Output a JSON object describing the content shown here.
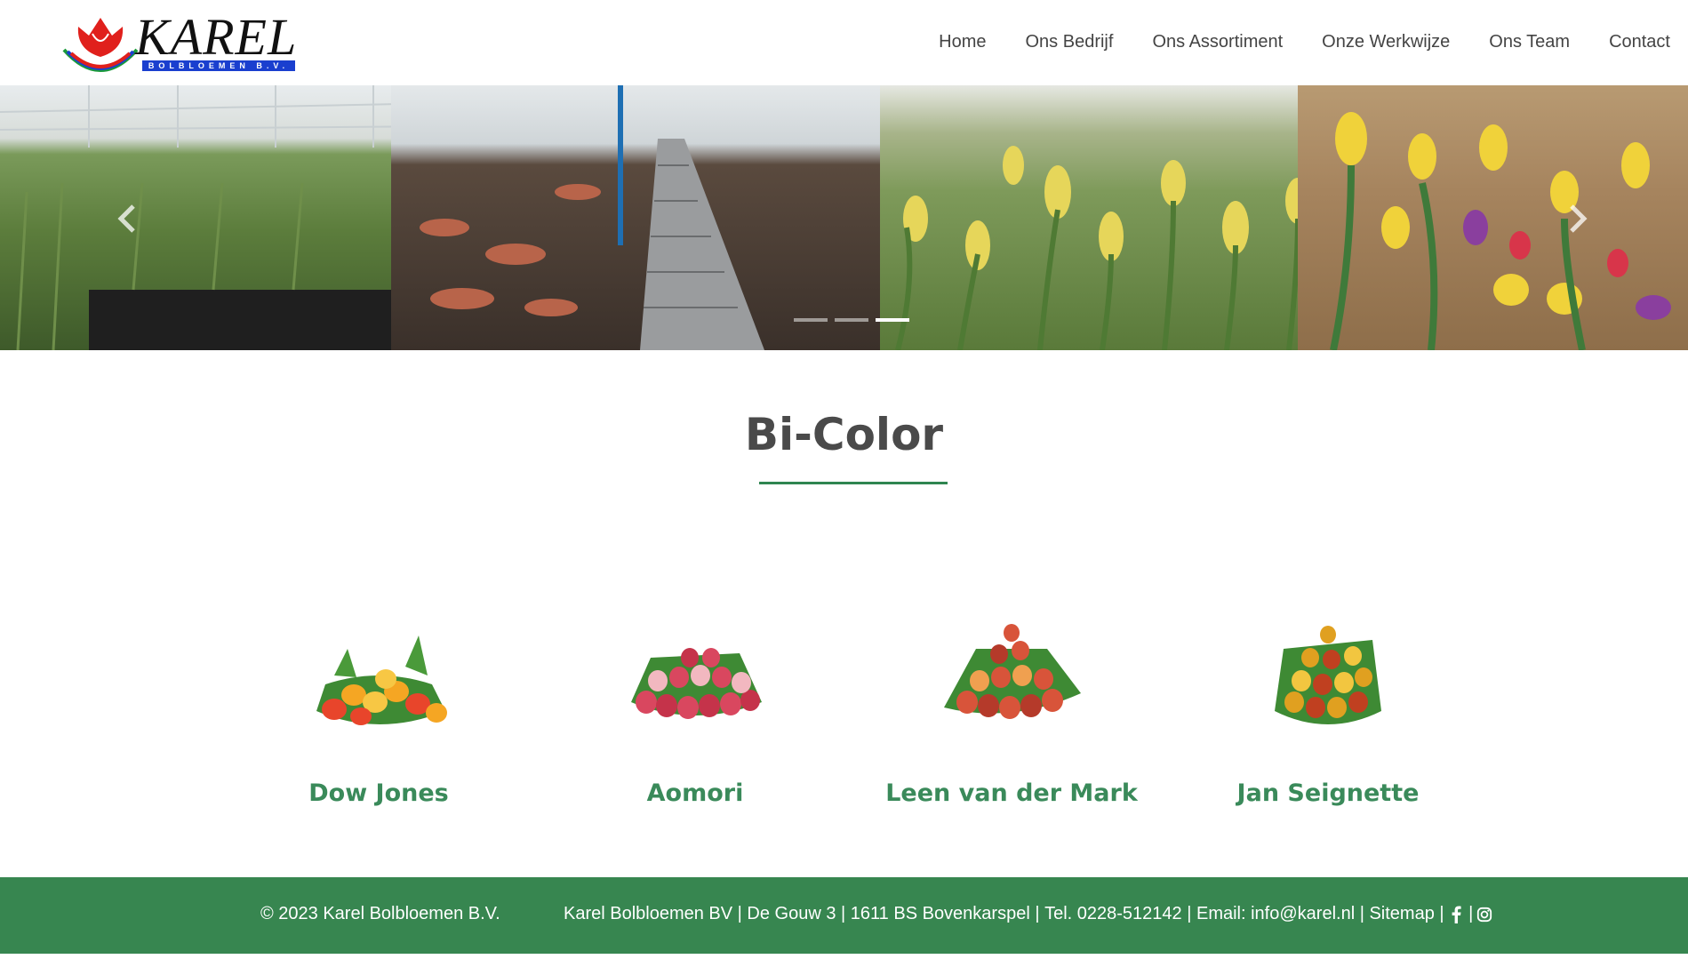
{
  "header": {
    "logo_text": "KAREL",
    "logo_subtext": "BOLBLOEMEN B.V.",
    "nav": [
      {
        "label": "Home"
      },
      {
        "label": "Ons Bedrijf"
      },
      {
        "label": "Ons Assortiment"
      },
      {
        "label": "Onze Werkwijze"
      },
      {
        "label": "Ons Team"
      },
      {
        "label": "Contact"
      }
    ]
  },
  "carousel": {
    "prev_icon": "chevron-left-icon",
    "next_icon": "chevron-right-icon",
    "slides_count": 3,
    "active_slide": 3
  },
  "main": {
    "title": "Bi-Color",
    "products": [
      {
        "name": "Dow Jones",
        "colors": [
          "#f5a623",
          "#e8452b",
          "#f7c744"
        ]
      },
      {
        "name": "Aomori",
        "colors": [
          "#d9475f",
          "#f2b8c0",
          "#c5334a"
        ]
      },
      {
        "name": "Leen van der Mark",
        "colors": [
          "#d8543a",
          "#f0a050",
          "#b53a2a"
        ]
      },
      {
        "name": "Jan Seignette",
        "colors": [
          "#e0a020",
          "#c04020",
          "#f2c640"
        ]
      }
    ]
  },
  "footer": {
    "copyright": "© 2023 Karel Bolbloemen B.V.",
    "company": "Karel Bolbloemen BV",
    "address": "De Gouw 3",
    "city": "1611 BS Bovenkarspel",
    "phone": "Tel. 0228-512142",
    "email_label": "Email: ",
    "email": "info@karel.nl",
    "sitemap": "Sitemap",
    "separator": " | ",
    "social": [
      "facebook-icon",
      "instagram-icon"
    ]
  },
  "colors": {
    "accent": "#378650",
    "product_name": "#3a8a5a",
    "logo_blue": "#1a3fcf",
    "logo_red": "#e0201c"
  }
}
